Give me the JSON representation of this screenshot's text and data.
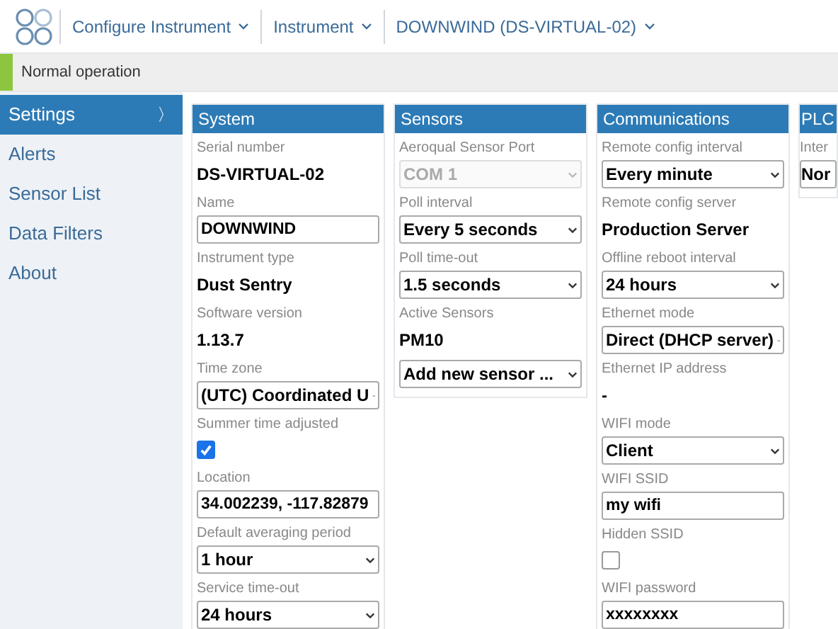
{
  "breadcrumbs": [
    {
      "label": "Configure Instrument"
    },
    {
      "label": "Instrument"
    },
    {
      "label": "DOWNWIND (DS-VIRTUAL-02)"
    }
  ],
  "status_bar": {
    "text": "Normal operation"
  },
  "sidebar": {
    "items": [
      {
        "label": "Settings",
        "selected": true,
        "arrow": "〉"
      },
      {
        "label": "Alerts",
        "selected": false
      },
      {
        "label": "Sensor List",
        "selected": false
      },
      {
        "label": "Data Filters",
        "selected": false
      },
      {
        "label": "About",
        "selected": false
      }
    ]
  },
  "panels": [
    {
      "title": "System",
      "fields": [
        {
          "kind": "text",
          "label": "Serial number",
          "value": "DS-VIRTUAL-02"
        },
        {
          "kind": "input",
          "label": "Name",
          "value": "DOWNWIND"
        },
        {
          "kind": "text",
          "label": "Instrument type",
          "value": "Dust Sentry"
        },
        {
          "kind": "text",
          "label": "Software version",
          "value": "1.13.7"
        },
        {
          "kind": "select",
          "label": "Time zone",
          "value": "(UTC) Coordinated U",
          "disabled": false
        },
        {
          "kind": "checkbox",
          "label": "Summer time adjusted",
          "checked": true
        },
        {
          "kind": "input",
          "label": "Location",
          "value": "34.002239, -117.82879"
        },
        {
          "kind": "select",
          "label": "Default averaging period",
          "value": "1 hour",
          "disabled": false
        },
        {
          "kind": "select",
          "label": "Service time-out",
          "value": "24 hours",
          "disabled": false
        }
      ]
    },
    {
      "title": "Sensors",
      "fields": [
        {
          "kind": "select",
          "label": "Aeroqual Sensor Port",
          "value": "COM 1",
          "disabled": true
        },
        {
          "kind": "select",
          "label": "Poll interval",
          "value": "Every 5 seconds",
          "disabled": false
        },
        {
          "kind": "select",
          "label": "Poll time-out",
          "value": "1.5 seconds",
          "disabled": false
        },
        {
          "kind": "text",
          "label": "Active Sensors",
          "value": "PM10"
        },
        {
          "kind": "select",
          "value": "Add new sensor ...",
          "disabled": false
        }
      ]
    },
    {
      "title": "Communications",
      "fields": [
        {
          "kind": "select",
          "label": "Remote config interval",
          "value": "Every minute",
          "disabled": false
        },
        {
          "kind": "text",
          "label": "Remote config server",
          "value": "Production Server"
        },
        {
          "kind": "select",
          "label": "Offline reboot interval",
          "value": "24 hours",
          "disabled": false
        },
        {
          "kind": "select",
          "label": "Ethernet mode",
          "value": "Direct (DHCP server)",
          "disabled": false
        },
        {
          "kind": "text",
          "label": "Ethernet IP address",
          "value": "-"
        },
        {
          "kind": "select",
          "label": "WIFI mode",
          "value": "Client",
          "disabled": false
        },
        {
          "kind": "input",
          "label": "WIFI SSID",
          "value": "my wifi"
        },
        {
          "kind": "checkbox",
          "label": "Hidden SSID",
          "checked": false
        },
        {
          "kind": "input",
          "label": "WIFI password",
          "value": "xxxxxxxx"
        }
      ]
    },
    {
      "title": "PLC",
      "fields": [
        {
          "kind": "select",
          "label": "Inter",
          "value": "Nor",
          "disabled": false,
          "nocaret": true
        }
      ]
    }
  ]
}
